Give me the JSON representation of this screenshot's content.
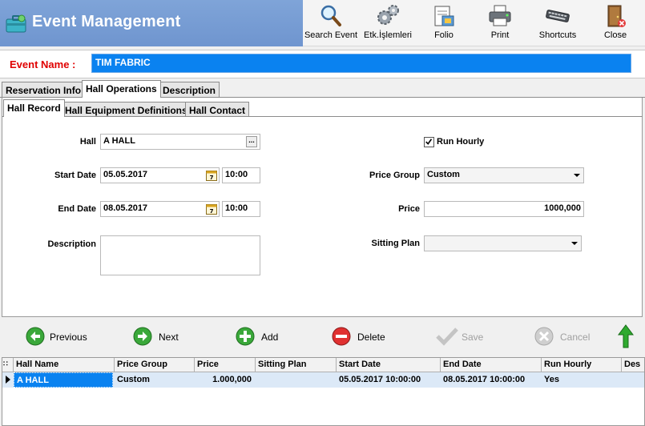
{
  "app": {
    "title": "Event Management"
  },
  "toolbar": {
    "items": [
      {
        "label": "Search Event",
        "icon": "magnifier-icon"
      },
      {
        "label": "Etk.İşlemleri",
        "icon": "gears-icon"
      },
      {
        "label": "Folio",
        "icon": "folio-icon"
      },
      {
        "label": "Print",
        "icon": "printer-icon"
      },
      {
        "label": "Shortcuts",
        "icon": "keyboard-icon"
      },
      {
        "label": "Close",
        "icon": "door-exit-icon"
      }
    ]
  },
  "event": {
    "label": "Event Name :",
    "value": "TIM FABRIC"
  },
  "tabs": [
    {
      "label": "Reservation Info"
    },
    {
      "label": "Hall Operations",
      "active": true
    },
    {
      "label": "Description"
    }
  ],
  "subtabs": [
    {
      "label": "Hall Record",
      "active": true
    },
    {
      "label": "Hall Equipment Definitions"
    },
    {
      "label": "Hall Contact"
    }
  ],
  "form": {
    "hall_label": "Hall",
    "hall_value": "A HALL",
    "hall_button": "...",
    "start_date_label": "Start Date",
    "start_date": "05.05.2017",
    "start_time": "10:00",
    "end_date_label": "End Date",
    "end_date": "08.05.2017",
    "end_time": "10:00",
    "description_label": "Description",
    "description_value": "",
    "run_hourly_label": "Run Hourly",
    "run_hourly_checked": true,
    "price_group_label": "Price Group",
    "price_group_value": "Custom",
    "price_label": "Price",
    "price_value": "1000,000",
    "sitting_plan_label": "Sitting Plan",
    "sitting_plan_value": "",
    "calendar_day": "7"
  },
  "nav": {
    "previous": "Previous",
    "next": "Next",
    "add": "Add",
    "delete": "Delete",
    "save": "Save",
    "cancel": "Cancel"
  },
  "grid": {
    "columns": [
      "Hall Name",
      "Price Group",
      "Price",
      "Sitting Plan",
      "Start Date",
      "End Date",
      "Run Hourly",
      "Des"
    ],
    "rows": [
      {
        "hall_name": "A HALL",
        "price_group": "Custom",
        "price": "1.000,000",
        "sitting_plan": "",
        "start_date": "05.05.2017 10:00:00",
        "end_date": "08.05.2017 10:00:00",
        "run_hourly": "Yes",
        "description": ""
      }
    ]
  },
  "colors": {
    "title_bar": "#6f95cf",
    "selection": "#0a82f0",
    "event_label": "#e00000",
    "row_selected": "#dce9f7"
  }
}
